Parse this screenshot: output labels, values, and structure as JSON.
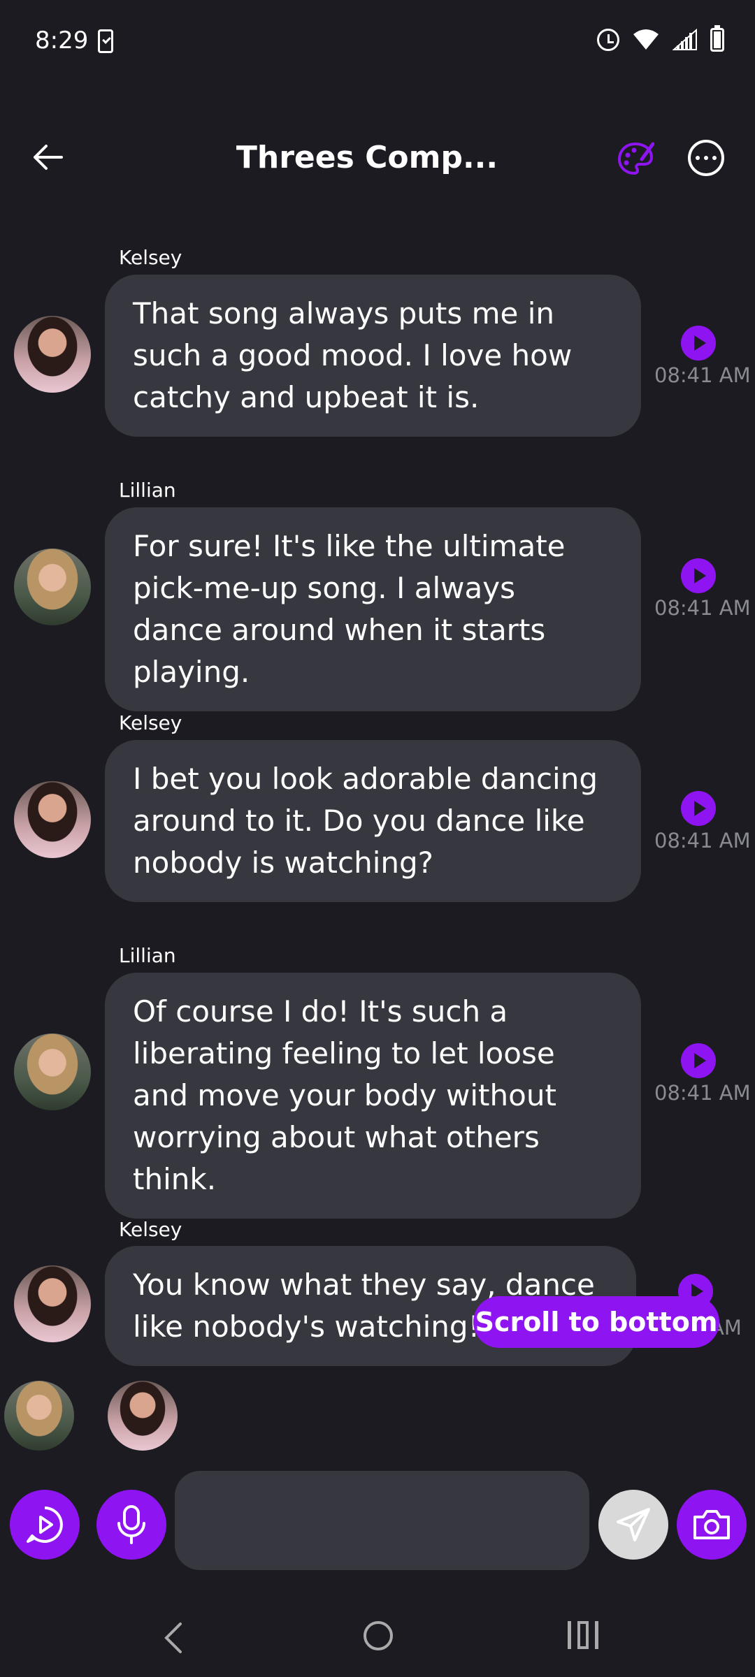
{
  "status_bar": {
    "time": "8:29",
    "icons": [
      "notification-check-icon",
      "alarm-icon",
      "wifi-icon",
      "signal-icon",
      "battery-icon"
    ]
  },
  "header": {
    "title": "Threes Comp...",
    "icons": [
      "back-arrow-icon",
      "palette-icon",
      "more-icon"
    ]
  },
  "messages": [
    {
      "sender": "Kelsey",
      "text": "That song always puts me in such a good mood. I love how catchy and upbeat it is.",
      "time": "08:41 AM"
    },
    {
      "sender": "Lillian",
      "text": "For sure! It's like the ultimate pick-me-up song. I always dance around when it starts playing.",
      "time": "08:41 AM"
    },
    {
      "sender": "Kelsey",
      "text": "I bet you look adorable dancing around to it. Do you dance like nobody is watching?",
      "time": "08:41 AM"
    },
    {
      "sender": "Lillian",
      "text": "Of course I do! It's such a liberating feeling to let loose and move your body without worrying about what others think.",
      "time": "08:41 AM"
    },
    {
      "sender": "Kelsey",
      "text": "You know what they say, dance like nobody's watching!",
      "time": "AM"
    }
  ],
  "scroll_button": {
    "label": "Scroll to bottom"
  },
  "input": {
    "placeholder": "",
    "value": ""
  },
  "colors": {
    "accent": "#8e14f1",
    "background": "#1b1b21",
    "bubble": "#37383f",
    "timestamp": "#8a8a93"
  }
}
